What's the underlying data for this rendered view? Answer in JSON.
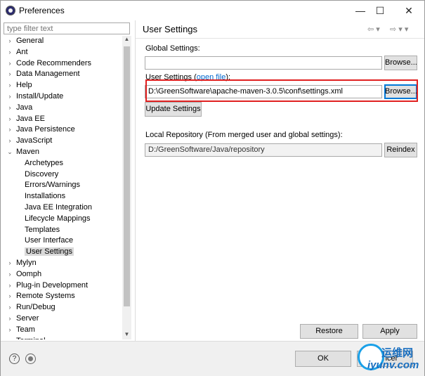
{
  "window": {
    "title": "Preferences",
    "icon": "eclipse-icon"
  },
  "window_controls": {
    "minimize": "—",
    "maximize": "☐",
    "close": "✕"
  },
  "filter": {
    "placeholder": "type filter text"
  },
  "tree": {
    "items": [
      {
        "label": "General",
        "level": 0,
        "toggle": "›"
      },
      {
        "label": "Ant",
        "level": 0,
        "toggle": "›"
      },
      {
        "label": "Code Recommenders",
        "level": 0,
        "toggle": "›"
      },
      {
        "label": "Data Management",
        "level": 0,
        "toggle": "›"
      },
      {
        "label": "Help",
        "level": 0,
        "toggle": "›"
      },
      {
        "label": "Install/Update",
        "level": 0,
        "toggle": "›"
      },
      {
        "label": "Java",
        "level": 0,
        "toggle": "›"
      },
      {
        "label": "Java EE",
        "level": 0,
        "toggle": "›"
      },
      {
        "label": "Java Persistence",
        "level": 0,
        "toggle": "›"
      },
      {
        "label": "JavaScript",
        "level": 0,
        "toggle": "›"
      },
      {
        "label": "Maven",
        "level": 0,
        "toggle": "⌄"
      },
      {
        "label": "Archetypes",
        "level": 1
      },
      {
        "label": "Discovery",
        "level": 1
      },
      {
        "label": "Errors/Warnings",
        "level": 1
      },
      {
        "label": "Installations",
        "level": 1
      },
      {
        "label": "Java EE Integration",
        "level": 1
      },
      {
        "label": "Lifecycle Mappings",
        "level": 1
      },
      {
        "label": "Templates",
        "level": 1
      },
      {
        "label": "User Interface",
        "level": 1
      },
      {
        "label": "User Settings",
        "level": 1,
        "selected": true
      },
      {
        "label": "Mylyn",
        "level": 0,
        "toggle": "›"
      },
      {
        "label": "Oomph",
        "level": 0,
        "toggle": "›"
      },
      {
        "label": "Plug-in Development",
        "level": 0,
        "toggle": "›"
      },
      {
        "label": "Remote Systems",
        "level": 0,
        "toggle": "›"
      },
      {
        "label": "Run/Debug",
        "level": 0,
        "toggle": "›"
      },
      {
        "label": "Server",
        "level": 0,
        "toggle": "›"
      },
      {
        "label": "Team",
        "level": 0,
        "toggle": "›"
      },
      {
        "label": "Terminal",
        "level": 0,
        "toggle": "›"
      }
    ]
  },
  "page": {
    "title": "User Settings",
    "nav_back": "⇦ ▾",
    "nav_forward": "⇨ ▾ ▾",
    "global_settings_label": "Global Settings:",
    "global_settings_value": "",
    "user_settings_label": "User Settings (",
    "open_file_link": "open file",
    "user_settings_label_end": "):",
    "user_settings_value": "D:\\GreenSoftware\\apache-maven-3.0.5\\conf\\settings.xml",
    "browse_label": "Browse...",
    "update_settings_label": "Update Settings",
    "local_repo_label": "Local Repository (From merged user and global settings):",
    "local_repo_value": "D:/GreenSoftware/Java/repository",
    "reindex_label": "Reindex",
    "restore_defaults_label": "Restore Defaults",
    "apply_label": "Apply"
  },
  "footer": {
    "ok_label": "OK",
    "cancel_label": "Cancel",
    "help_icon": "?"
  },
  "watermark": {
    "line1": "运维网",
    "line2": "iyunv.com"
  },
  "colors": {
    "highlight_border": "#e02020",
    "link": "#0066cc",
    "focus": "#0078d7"
  }
}
